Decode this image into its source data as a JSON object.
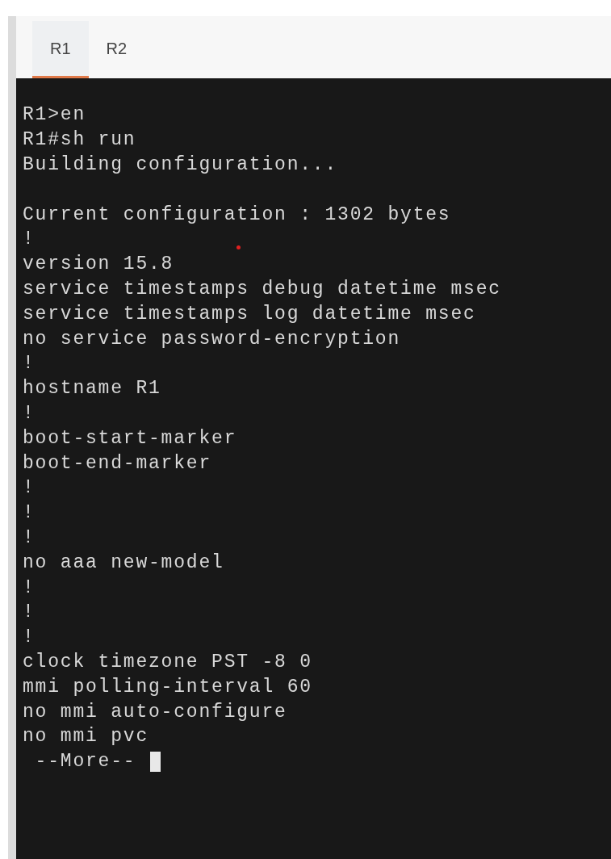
{
  "tabs": [
    {
      "label": "R1",
      "selected": true
    },
    {
      "label": "R2",
      "selected": false
    }
  ],
  "terminal": {
    "lines": [
      {
        "kind": "text",
        "text": "R1>en"
      },
      {
        "kind": "text",
        "text": "R1#sh run"
      },
      {
        "kind": "text",
        "text": "Building configuration..."
      },
      {
        "kind": "blank"
      },
      {
        "kind": "text",
        "text": "Current configuration : 1302 bytes"
      },
      {
        "kind": "text",
        "text": "!"
      },
      {
        "kind": "text",
        "text": "version 15.8"
      },
      {
        "kind": "text",
        "text": "service timestamps debug datetime msec"
      },
      {
        "kind": "text",
        "text": "service timestamps log datetime msec"
      },
      {
        "kind": "text",
        "text": "no service password-encryption"
      },
      {
        "kind": "text",
        "text": "!"
      },
      {
        "kind": "text",
        "text": "hostname R1"
      },
      {
        "kind": "text",
        "text": "!"
      },
      {
        "kind": "text",
        "text": "boot-start-marker"
      },
      {
        "kind": "text",
        "text": "boot-end-marker"
      },
      {
        "kind": "text",
        "text": "!"
      },
      {
        "kind": "text",
        "text": "!"
      },
      {
        "kind": "text",
        "text": "!"
      },
      {
        "kind": "text",
        "text": "no aaa new-model"
      },
      {
        "kind": "text",
        "text": "!"
      },
      {
        "kind": "text",
        "text": "!"
      },
      {
        "kind": "text",
        "text": "!"
      },
      {
        "kind": "text",
        "text": "clock timezone PST -8 0"
      },
      {
        "kind": "text",
        "text": "mmi polling-interval 60"
      },
      {
        "kind": "text",
        "text": "no mmi auto-configure"
      },
      {
        "kind": "text",
        "text": "no mmi pvc"
      },
      {
        "kind": "prompt",
        "text": " --More-- "
      }
    ]
  }
}
